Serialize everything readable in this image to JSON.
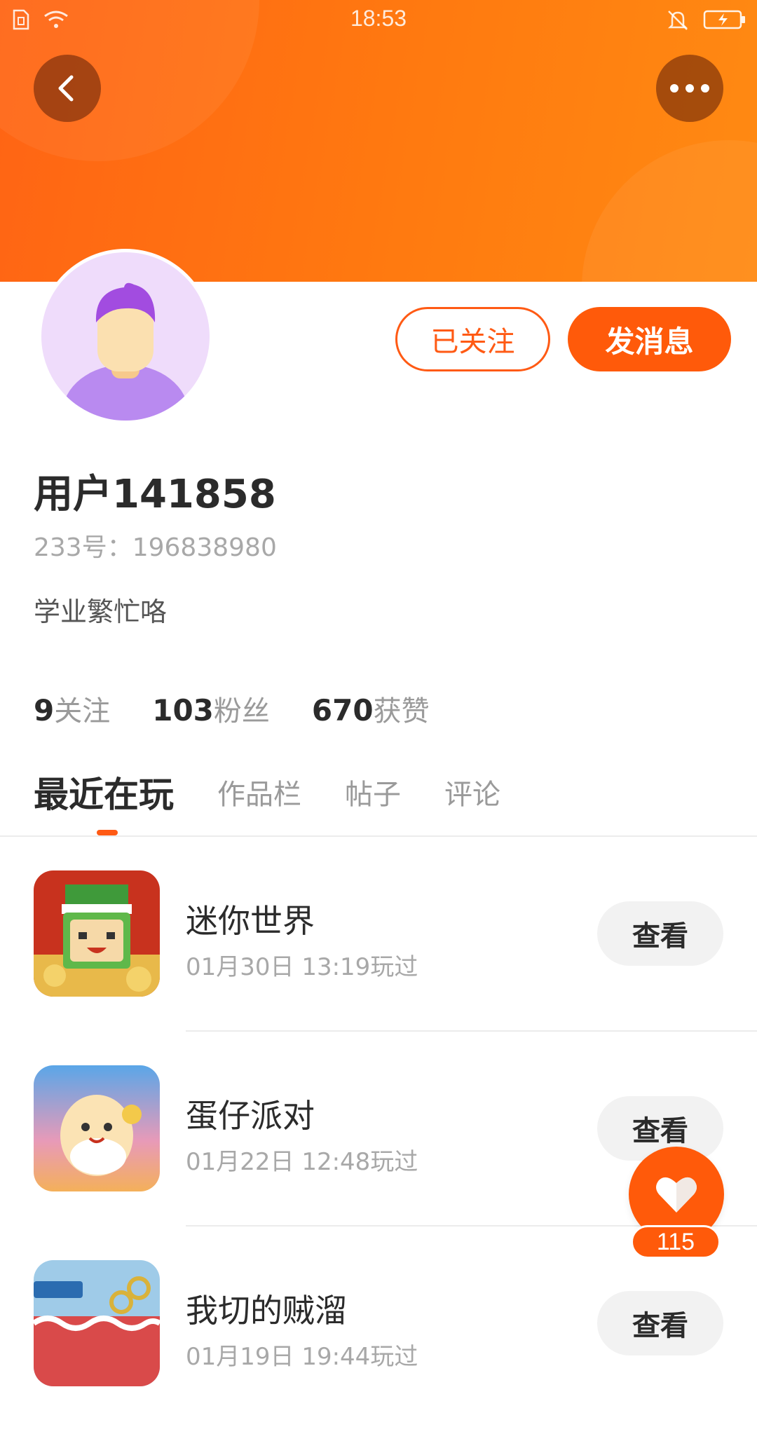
{
  "status_bar": {
    "time": "18:53"
  },
  "header": {
    "back_icon": "chevron-left-icon",
    "more_icon": "more-horizontal-icon"
  },
  "profile": {
    "username": "用户141858",
    "user_id": "233号：196838980",
    "bio": "学业繁忙咯",
    "follow_button": "已关注",
    "message_button": "发消息"
  },
  "stats": [
    {
      "value": "9",
      "label": "关注"
    },
    {
      "value": "103",
      "label": "粉丝"
    },
    {
      "value": "670",
      "label": "获赞"
    }
  ],
  "tabs": [
    {
      "label": "最近在玩",
      "active": true
    },
    {
      "label": "作品栏",
      "active": false
    },
    {
      "label": "帖子",
      "active": false
    },
    {
      "label": "评论",
      "active": false
    }
  ],
  "games": [
    {
      "name": "迷你世界",
      "played": "01月30日 13:19玩过",
      "button": "查看"
    },
    {
      "name": "蛋仔派对",
      "played": "01月22日 12:48玩过",
      "button": "查看"
    },
    {
      "name": "我切的贼溜",
      "played": "01月19日 19:44玩过",
      "button": "查看"
    }
  ],
  "like": {
    "count": "115",
    "icon": "heart-icon"
  },
  "colors": {
    "accent": "#ff5a0a",
    "banner_start": "#ff6414",
    "banner_end": "#ff8a12"
  }
}
